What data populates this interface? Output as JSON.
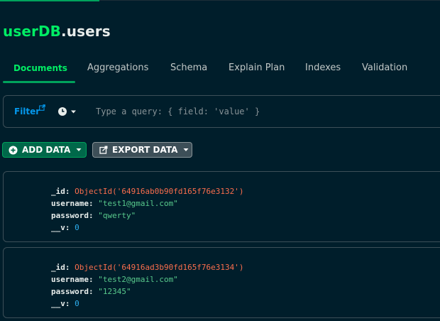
{
  "header": {
    "db_name": "userDB",
    "collection": ".users"
  },
  "tabs": [
    {
      "label": "Documents",
      "active": true
    },
    {
      "label": "Aggregations"
    },
    {
      "label": "Schema"
    },
    {
      "label": "Explain Plan"
    },
    {
      "label": "Indexes"
    },
    {
      "label": "Validation"
    }
  ],
  "filter": {
    "label": "Filter",
    "placeholder": "Type a query: { field: 'value' }",
    "history_icon": "clock-icon"
  },
  "toolbar": {
    "add_data": "ADD DATA",
    "export_data": "EXPORT DATA"
  },
  "documents": [
    {
      "id_key": "_id:",
      "id_value": "ObjectId('64916ab0b90fd165f76e3132')",
      "username_key": "username:",
      "username_value": "\"test1@gmail.com\"",
      "password_key": "password:",
      "password_value": "\"qwerty\"",
      "v_key": "__v:",
      "v_value": "0"
    },
    {
      "id_key": "_id:",
      "id_value": "ObjectId('64916ad3b90fd165f76e3134')",
      "username_key": "username:",
      "username_value": "\"test2@gmail.com\"",
      "password_key": "password:",
      "password_value": "\"12345\"",
      "v_key": "__v:",
      "v_value": "0"
    }
  ],
  "colors": {
    "background": "#001e2b",
    "brand_green": "#00ed64",
    "link_blue": "#0498ec",
    "objectid": "#fa6e4d",
    "string": "#58c98c",
    "number": "#2dafee"
  }
}
